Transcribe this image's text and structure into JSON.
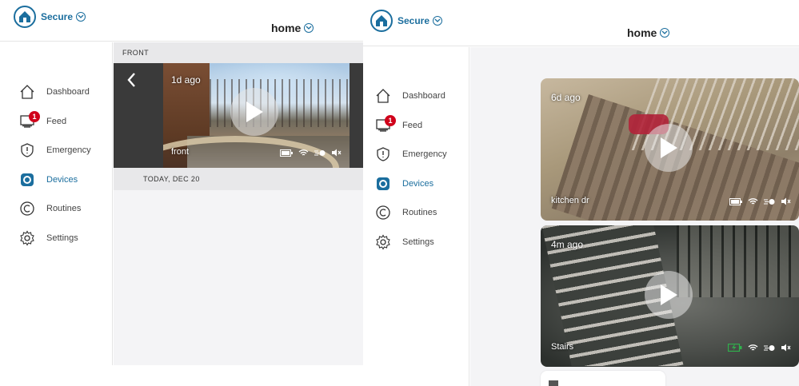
{
  "colors": {
    "brand": "#1b6e9e",
    "badge": "#d0021b",
    "charging": "#2fb24c"
  },
  "left_panel": {
    "brand": {
      "label": "Secure",
      "logo_icon": "house-icon"
    },
    "location": "home",
    "nav": [
      {
        "id": "dashboard",
        "label": "Dashboard",
        "icon": "house-icon"
      },
      {
        "id": "feed",
        "label": "Feed",
        "icon": "monitor-icon",
        "badge": "1"
      },
      {
        "id": "emergency",
        "label": "Emergency",
        "icon": "shield-icon"
      },
      {
        "id": "devices",
        "label": "Devices",
        "icon": "camera-icon",
        "active": true
      },
      {
        "id": "routines",
        "label": "Routines",
        "icon": "routine-icon"
      },
      {
        "id": "settings",
        "label": "Settings",
        "icon": "gear-icon"
      }
    ],
    "section_title": "FRONT",
    "player": {
      "time_ago": "1d ago",
      "camera_name": "front"
    },
    "date_header": "TODAY, DEC 20"
  },
  "right_panel": {
    "brand": {
      "label": "Secure",
      "logo_icon": "house-icon"
    },
    "location": "home",
    "nav": [
      {
        "id": "dashboard",
        "label": "Dashboard",
        "icon": "house-icon"
      },
      {
        "id": "feed",
        "label": "Feed",
        "icon": "monitor-icon",
        "badge": "1"
      },
      {
        "id": "emergency",
        "label": "Emergency",
        "icon": "shield-icon"
      },
      {
        "id": "devices",
        "label": "Devices",
        "icon": "camera-icon",
        "active": true
      },
      {
        "id": "routines",
        "label": "Routines",
        "icon": "routine-icon"
      },
      {
        "id": "settings",
        "label": "Settings",
        "icon": "gear-icon"
      }
    ],
    "cameras": [
      {
        "time_ago": "6d ago",
        "name": "kitchen dr",
        "battery": "full",
        "signal": "wifi",
        "motion": "on",
        "audio": "muted"
      },
      {
        "time_ago": "4m ago",
        "name": "Stairs",
        "battery": "charging",
        "signal": "wifi",
        "motion": "on",
        "audio": "muted"
      }
    ]
  }
}
